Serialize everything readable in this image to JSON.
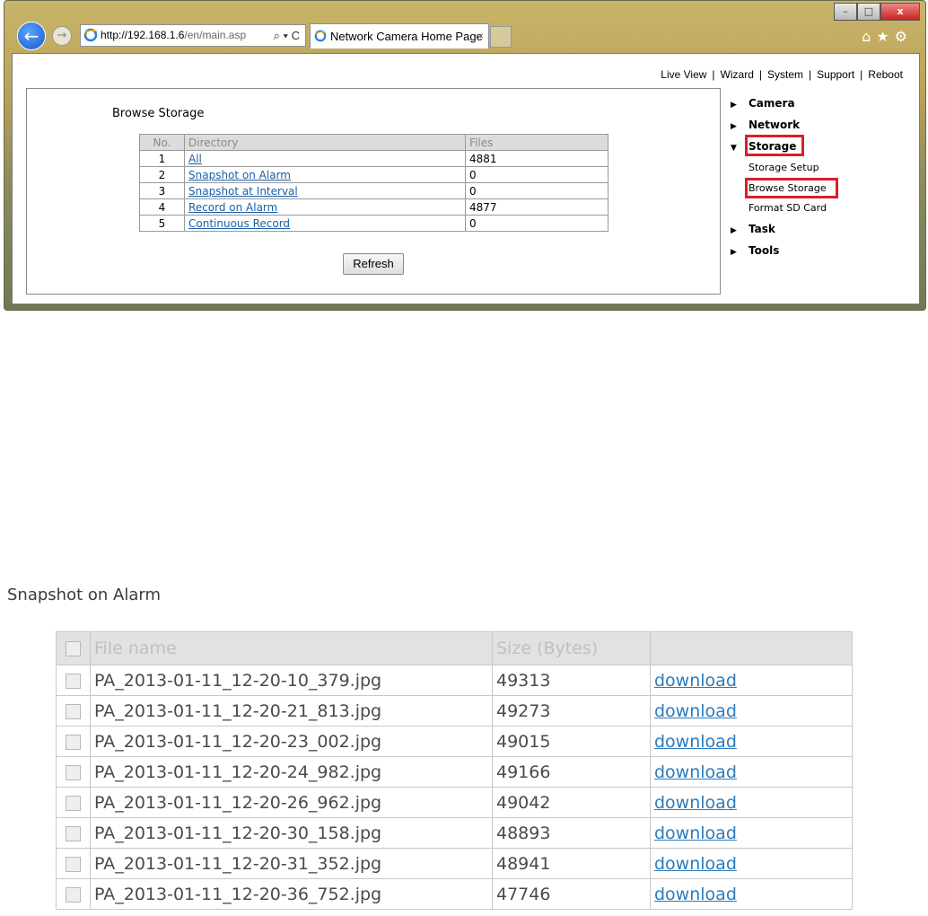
{
  "browser": {
    "address_host": "http://192.168.1.6",
    "address_path": "/en/main.asp",
    "address_controls": "⌕ ▾ C",
    "tab_title": "Network Camera Home Page",
    "tab_close": "×",
    "back_icon": "←",
    "forward_icon": "→",
    "minimize": "–",
    "maximize": "□",
    "close": "x",
    "toolbar_icons": "⌂★⚙"
  },
  "topnav": {
    "items": [
      "Live View",
      "Wizard",
      "System",
      "Support",
      "Reboot"
    ],
    "separator": "|"
  },
  "panel": {
    "title": "Browse Storage",
    "headers": [
      "No.",
      "Directory",
      "Files"
    ],
    "rows": [
      {
        "no": "1",
        "directory": "All",
        "files": "4881"
      },
      {
        "no": "2",
        "directory": "Snapshot on Alarm",
        "files": "0"
      },
      {
        "no": "3",
        "directory": "Snapshot at Interval",
        "files": "0"
      },
      {
        "no": "4",
        "directory": "Record on Alarm",
        "files": "4877"
      },
      {
        "no": "5",
        "directory": "Continuous Record",
        "files": "0"
      }
    ],
    "refresh_label": "Refresh"
  },
  "sidebar": {
    "camera": "Camera",
    "network": "Network",
    "storage": "Storage",
    "storage_setup": "Storage Setup",
    "browse_storage": "Browse Storage",
    "format_sd": "Format SD Card",
    "task": "Task",
    "tools": "Tools",
    "arrow_right": "▶",
    "arrow_down": "▼"
  },
  "highlight_color": "#d8202b",
  "files_section": {
    "title": "Snapshot on Alarm",
    "headers": [
      "File name",
      "Size (Bytes)",
      ""
    ],
    "rows": [
      {
        "name": "PA_2013-01-11_12-20-10_379.jpg",
        "size": "49313",
        "link": "download"
      },
      {
        "name": "PA_2013-01-11_12-20-21_813.jpg",
        "size": "49273",
        "link": "download"
      },
      {
        "name": "PA_2013-01-11_12-20-23_002.jpg",
        "size": "49015",
        "link": "download"
      },
      {
        "name": "PA_2013-01-11_12-20-24_982.jpg",
        "size": "49166",
        "link": "download"
      },
      {
        "name": "PA_2013-01-11_12-20-26_962.jpg",
        "size": "49042",
        "link": "download"
      },
      {
        "name": "PA_2013-01-11_12-20-30_158.jpg",
        "size": "48893",
        "link": "download"
      },
      {
        "name": "PA_2013-01-11_12-20-31_352.jpg",
        "size": "48941",
        "link": "download"
      },
      {
        "name": "PA_2013-01-11_12-20-36_752.jpg",
        "size": "47746",
        "link": "download"
      }
    ]
  }
}
